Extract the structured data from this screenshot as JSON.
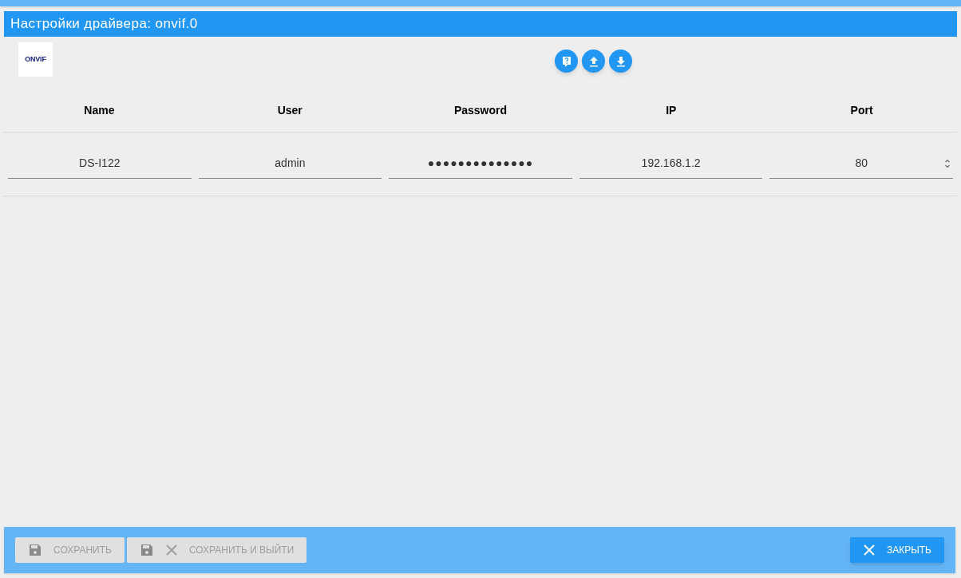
{
  "dialog": {
    "title": "Настройки драйвера: onvif.0"
  },
  "logo": {
    "text": "ONVIF"
  },
  "toolbar": [
    {
      "kind": "help"
    },
    {
      "kind": "upload"
    },
    {
      "kind": "download"
    }
  ],
  "table": {
    "columns": [
      "Name",
      "User",
      "Password",
      "IP",
      "Port"
    ],
    "rows": [
      {
        "cells": [
          {
            "kind": "text",
            "value": "DS-I122"
          },
          {
            "kind": "text",
            "value": "admin"
          },
          {
            "kind": "password",
            "value": "●●●●●●●●●●●●●●"
          },
          {
            "kind": "text",
            "value": "192.168.1.2"
          },
          {
            "kind": "number",
            "value": "80"
          }
        ]
      }
    ]
  },
  "footer": {
    "buttons": [
      {
        "kind": "save",
        "label": "СОХРАНИТЬ",
        "disabled": true
      },
      {
        "kind": "save-close",
        "label": "СОХРАНИТЬ И ВЫЙТИ",
        "disabled": true
      },
      {
        "kind": "close",
        "label": "ЗАКРЫТЬ",
        "disabled": false
      }
    ]
  }
}
